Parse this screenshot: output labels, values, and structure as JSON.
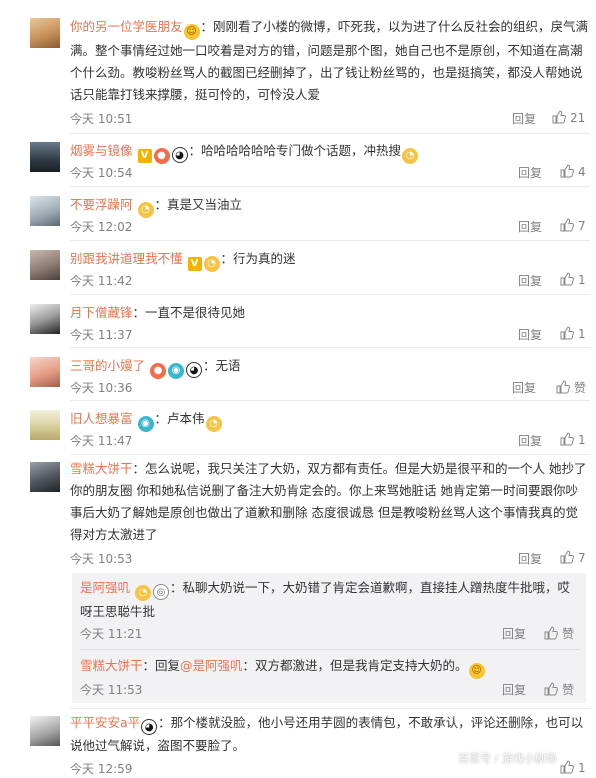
{
  "ui": {
    "reply_label": "回复",
    "like_zero_label": "赞"
  },
  "comments": [
    {
      "user": "你的另一位学医朋友",
      "text": "：刚刚看了小楼的微博，吓死我，以为进了什么反社会的组织，戾气满满。整个事情经过她一口咬着是对方的错，问题是那个图，她自己也不是原创，不知道在高潮个什么劲。教唆粉丝骂人的截图已经删掉了，出了钱让粉丝骂的，也是挺搞笑，都没人帮她说话只能靠打钱来撑腰，挺可怜的，可怜没人爱",
      "time": "今天 10:51",
      "likes": "21"
    },
    {
      "user": "烟雾与镜像",
      "text": "：哈哈哈哈哈哈专门做个话题，冲热搜",
      "time": "今天 10:54",
      "likes": "4"
    },
    {
      "user": "不要浮躁阿",
      "text": "：真是又当油立",
      "time": "今天 12:02",
      "likes": "7"
    },
    {
      "user": "别跟我讲道理我不懂",
      "text": "：行为真的迷",
      "time": "今天 11:42",
      "likes": "1"
    },
    {
      "user": "月下僧藏锋",
      "text": "：一直不是很待见她",
      "time": "今天 11:37",
      "likes": "1"
    },
    {
      "user": "三哥的小嫚了",
      "text": "：无语",
      "time": "今天 10:36",
      "likes": "赞"
    },
    {
      "user": "旧人想暴富",
      "text": "：卢本伟",
      "time": "今天 11:47",
      "likes": "1"
    },
    {
      "user": "雪糕大饼干",
      "text": "：怎么说呢，我只关注了大奶，双方都有责任。但是大奶是很平和的一个人 她抄了你的朋友圈 你和她私信说删了备注大奶肯定会的。你上来骂她脏话 她肯定第一时间要跟你吵 事后大奶了解她是原创也做出了道歉和删除 态度很诚恳 但是教唆粉丝骂人这个事情我真的觉得对方太激进了",
      "time": "今天 10:53",
      "likes": "7"
    },
    {
      "user": "平平安安a平",
      "text": "：那个楼就没脸，他小号还用芋圆的表情包，不敢承认，评论还删除，也可以说他过气解说，盗图不要脸了。",
      "time": "今天 12:59",
      "likes": "1"
    }
  ],
  "replies": [
    {
      "user": "是阿强叽",
      "text": "：私聊大奶说一下，大奶错了肯定会道歉啊，直接挂人蹭热度牛批哦，哎呀王思聪牛批",
      "time": "今天 11:21",
      "likes": "赞"
    },
    {
      "user": "雪糕大饼干",
      "text_prefix": "：回复",
      "mention": "@是阿强叽",
      "text": "：双方都激进，但是我肯定支持大奶的。",
      "time": "今天 11:53",
      "likes": "赞"
    }
  ],
  "watermark": "百家号 / 游戏小剧场"
}
